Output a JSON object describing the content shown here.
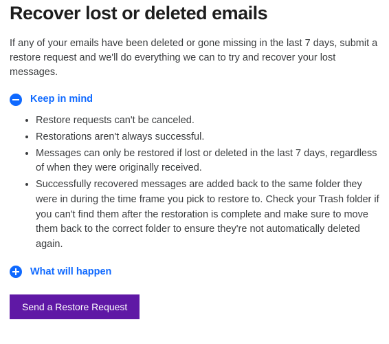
{
  "page": {
    "title": "Recover lost or deleted emails",
    "intro": "If any of your emails have been deleted or gone missing in the last 7 days, submit a restore request and we'll do everything we can to try and recover your lost messages."
  },
  "sections": {
    "keep_in_mind": {
      "title": "Keep in mind",
      "items": [
        "Restore requests can't be canceled.",
        "Restorations aren't always successful.",
        "Messages can only be restored if lost or deleted in the last 7 days, regardless of when they were originally received.",
        "Successfully recovered messages are added back to the same folder they were in during the time frame you pick to restore to. Check your Trash folder if you can't find them after the restoration is complete and make sure to move them back to the correct folder to ensure they're not automatically deleted again."
      ]
    },
    "what_will_happen": {
      "title": "What will happen"
    }
  },
  "actions": {
    "restore_button": "Send a Restore Request"
  },
  "colors": {
    "accent_blue": "#0f69ff",
    "button_purple": "#5f18a5"
  }
}
